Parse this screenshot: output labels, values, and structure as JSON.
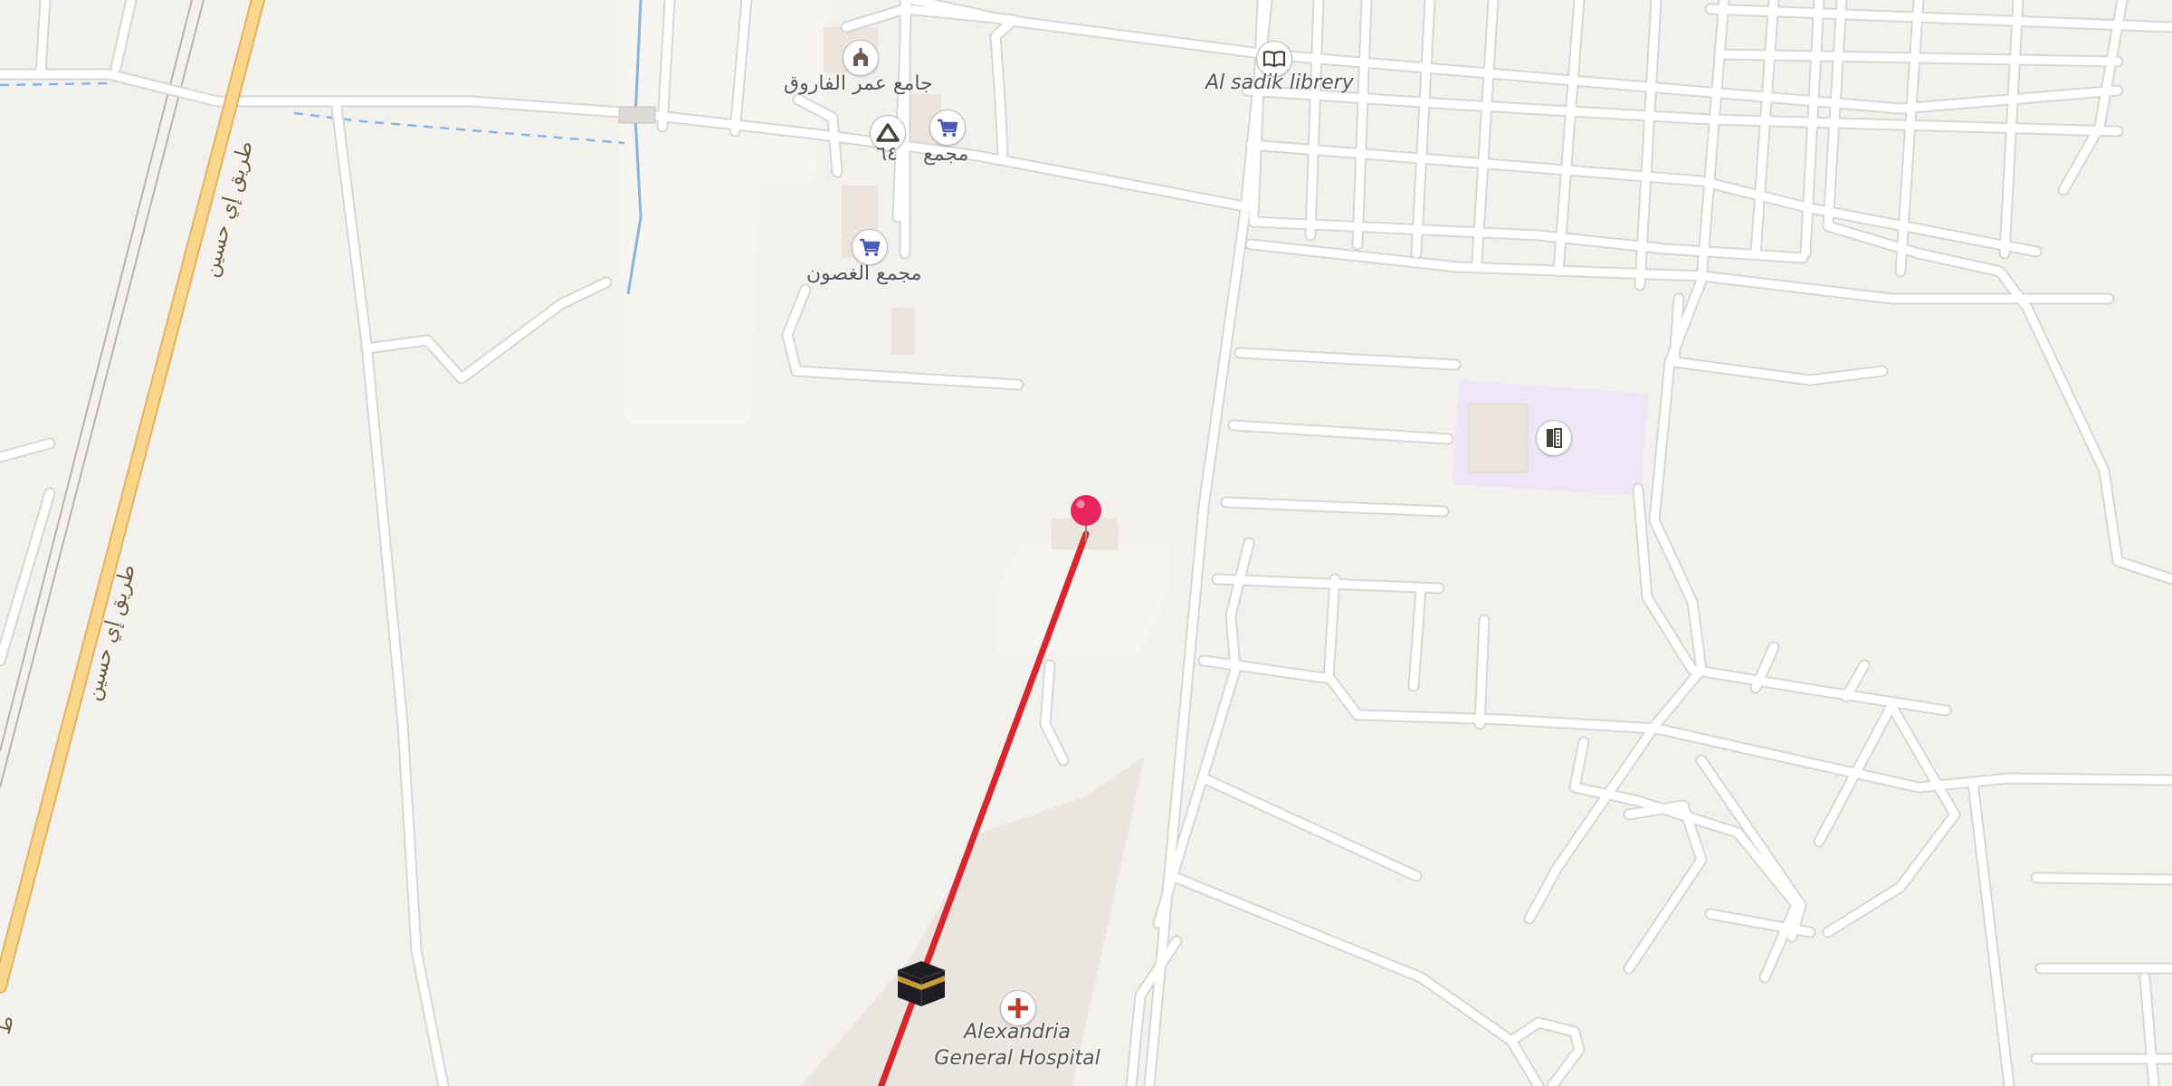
{
  "map": {
    "labels": {
      "mosque": "جامع عمر الفاروق",
      "camp": "٦٤",
      "shop_a": "مجمع",
      "shop_b": "مجمع الغصون",
      "library": "Al sadik librery",
      "hospital_line1": "Alexandria",
      "hospital_line2": "General Hospital",
      "road_upper": "طريق إي حسين",
      "road_lower": "طريق إي حسين",
      "edge_glyph": "ط"
    },
    "icons": [
      "mosque-icon",
      "camp-icon",
      "shopping-cart-icon",
      "book-icon",
      "school-icon",
      "hospital-cross-icon",
      "kaaba-icon",
      "location-pin-icon"
    ],
    "colors": {
      "land": "#f3f1ee",
      "road": "#ffffff",
      "road_casing": "#d9d6d2",
      "major_road": "#f9d68c",
      "major_road_casing": "#e4b15c",
      "water": "#8ab4e0",
      "route_line": "#d9262c",
      "pin": "#e8245c",
      "school_area": "#ece6f7",
      "building": "#ebe4dd",
      "cart": "#4a5bb5",
      "hospital_cross": "#c0392b"
    }
  }
}
